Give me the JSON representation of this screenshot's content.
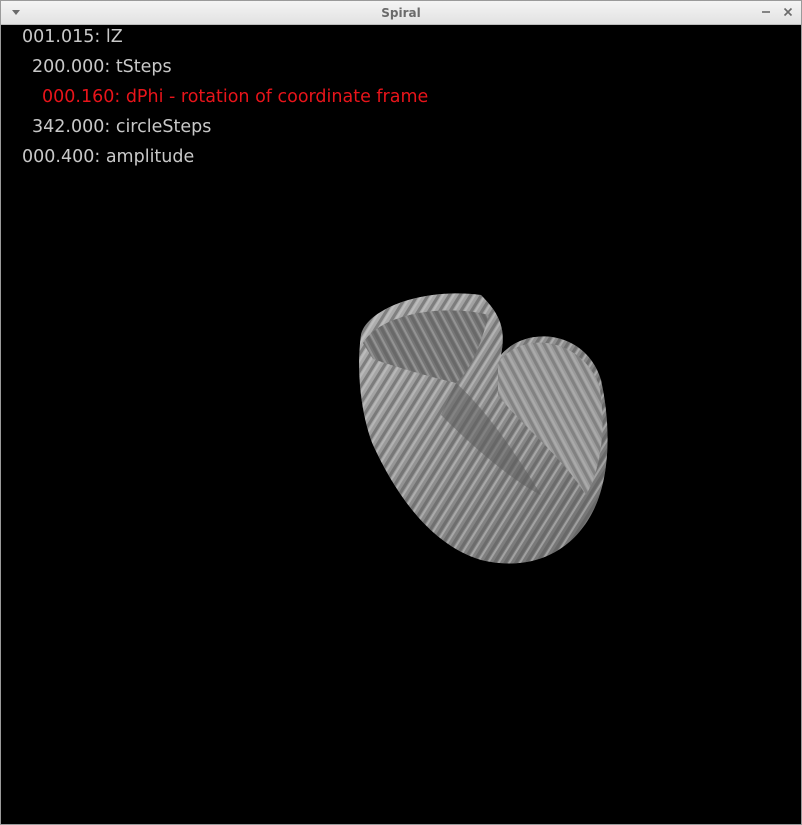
{
  "window": {
    "title": "Spiral"
  },
  "icons": {
    "menu": "chevron-down-icon",
    "minimize": "minimize-icon",
    "close": "close-icon"
  },
  "hud": {
    "lines": [
      {
        "text": "001.015: lZ",
        "active": false
      },
      {
        "text": "200.000: tSteps",
        "active": false
      },
      {
        "text": "000.160: dPhi - rotation of coordinate frame",
        "active": true
      },
      {
        "text": "342.000: circleSteps",
        "active": false
      },
      {
        "text": "000.400: amplitude",
        "active": false
      }
    ]
  },
  "colors": {
    "background": "#000000",
    "hud_text": "#c8c8c8",
    "hud_active": "#e8141a",
    "surface": "#8c8c8c"
  }
}
